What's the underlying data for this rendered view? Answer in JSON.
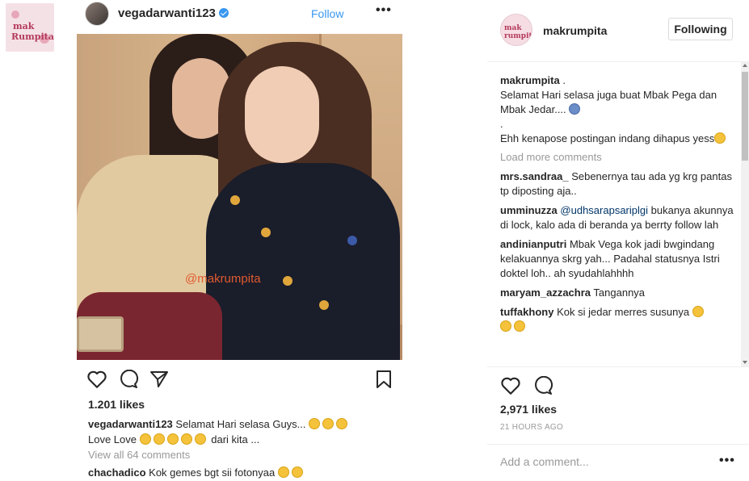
{
  "embedded_post": {
    "username": "vegadarwanti123",
    "follow_label": "Follow",
    "more_label": "•••",
    "watermark": "@makrumpita",
    "likes": "1.201 likes",
    "caption_user": "vegadarwanti123",
    "caption_text": "Selamat Hari selasa Guys...",
    "caption_line2": "Love Love",
    "caption_tail": "dari kita ...",
    "view_all": "View all 64 comments",
    "comment_user": "chachadico",
    "comment_text": "Kok gemes bgt sii fotonyaa"
  },
  "post": {
    "username": "makrumpita",
    "avatar_text": "mak rumpita",
    "following_label": "Following",
    "caption": {
      "user": "makrumpita",
      "user_suffix": ".",
      "line1": "Selamat Hari selasa juga buat Mbak Pega dan Mbak Jedar....",
      "line2": ".",
      "line3": "Ehh kenapose postingan indang dihapus yess"
    },
    "load_more": "Load more comments",
    "comments": [
      {
        "user": "mrs.sandraa_",
        "text": "Sebenernya tau ada yg krg pantas tp diposting aja.."
      },
      {
        "user": "umminuzza",
        "mention": "@udhsarapsariplgi",
        "text": "bukanya akunnya di lock, kalo ada di beranda ya berrty follow lah"
      },
      {
        "user": "andinianputri",
        "text": "Mbak Vega kok jadi bwgindang kelakuannya skrg yah... Padahal statusnya Istri doktel loh.. ah syudahlahhhh"
      },
      {
        "user": "maryam_azzachra",
        "text": "Tangannya"
      },
      {
        "user": "tuffakhony",
        "text": "Kok si jedar merres susunya"
      }
    ],
    "likes": "2,971 likes",
    "time": "21 HOURS AGO",
    "add_comment_placeholder": "Add a comment...",
    "more_label": "•••"
  },
  "icons": [
    "heart-icon",
    "comment-icon",
    "share-icon",
    "bookmark-icon",
    "verified-icon"
  ],
  "colors": {
    "link_blue": "#3897f0",
    "muted": "#999999",
    "text": "#262626"
  }
}
